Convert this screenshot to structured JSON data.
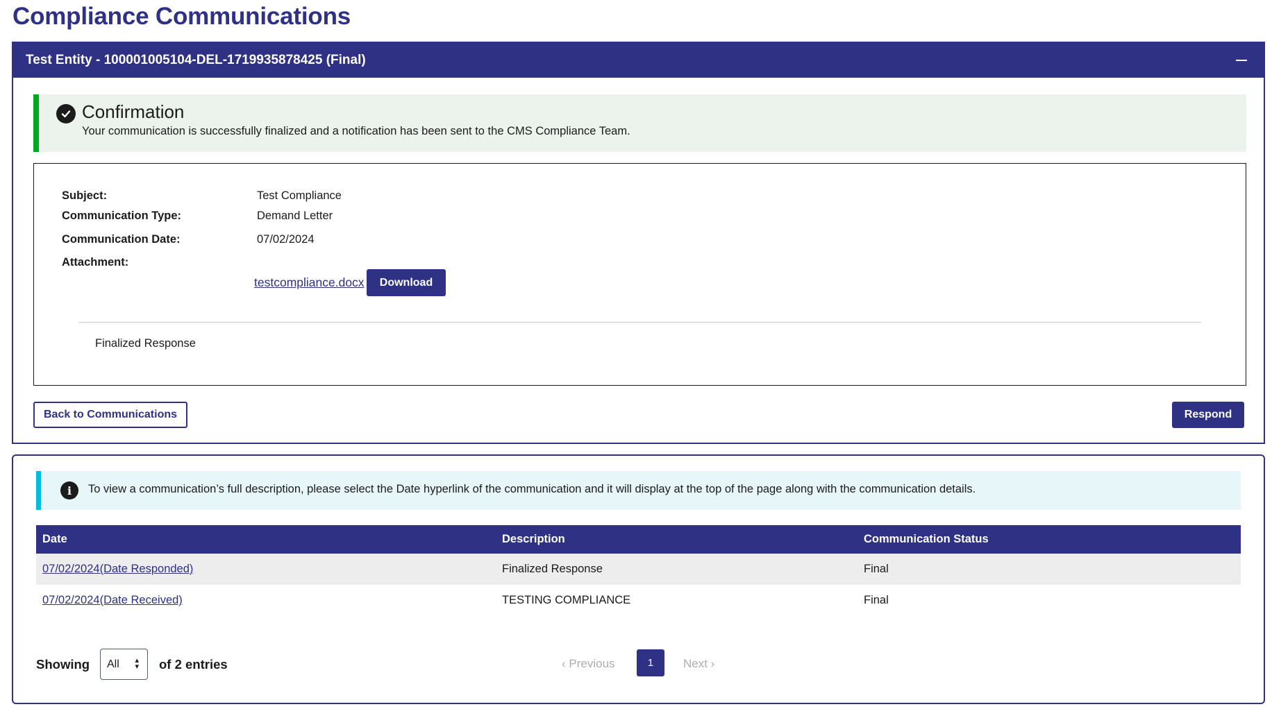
{
  "page_title": "Compliance Communications",
  "panel": {
    "title": "Test Entity - 100001005104-DEL-1719935878425 (Final)"
  },
  "confirmation": {
    "heading": "Confirmation",
    "message": "Your communication is successfully finalized and a notification has been sent to the CMS Compliance Team."
  },
  "details": {
    "subject_label": "Subject:",
    "subject_value": "Test Compliance",
    "type_label": "Communication Type:",
    "type_value": "Demand Letter",
    "date_label": "Communication Date:",
    "date_value": "07/02/2024",
    "attachment_label": "Attachment:",
    "attachment_file": "testcompliance.docx",
    "download_label": "Download",
    "body_text": "Finalized Response"
  },
  "actions": {
    "back_label": "Back to Communications",
    "respond_label": "Respond"
  },
  "info_alert": {
    "icon": "i",
    "text": "To view a communication’s full description, please select the Date hyperlink of the communication and it will display at the top of the page along with the communication details."
  },
  "table": {
    "headers": [
      "Date",
      "Description",
      "Communication Status"
    ],
    "rows": [
      {
        "date": "07/02/2024(Date Responded)",
        "description": "Finalized Response",
        "status": "Final"
      },
      {
        "date": "07/02/2024(Date Received)",
        "description": "TESTING COMPLIANCE",
        "status": "Final"
      }
    ]
  },
  "pagination": {
    "showing_label": "Showing",
    "page_size": "All",
    "entries_label": "of 2 entries",
    "previous_label": "‹ Previous",
    "current_page": "1",
    "next_label": "Next ›"
  },
  "colors": {
    "primary": "#2e3184",
    "success": "#00a91c",
    "info": "#00bde3"
  },
  "icons": {
    "confirmation": "check-circle-icon",
    "collapse": "minus-icon",
    "info": "info-circle-icon",
    "select": "sort-arrows-icon"
  }
}
